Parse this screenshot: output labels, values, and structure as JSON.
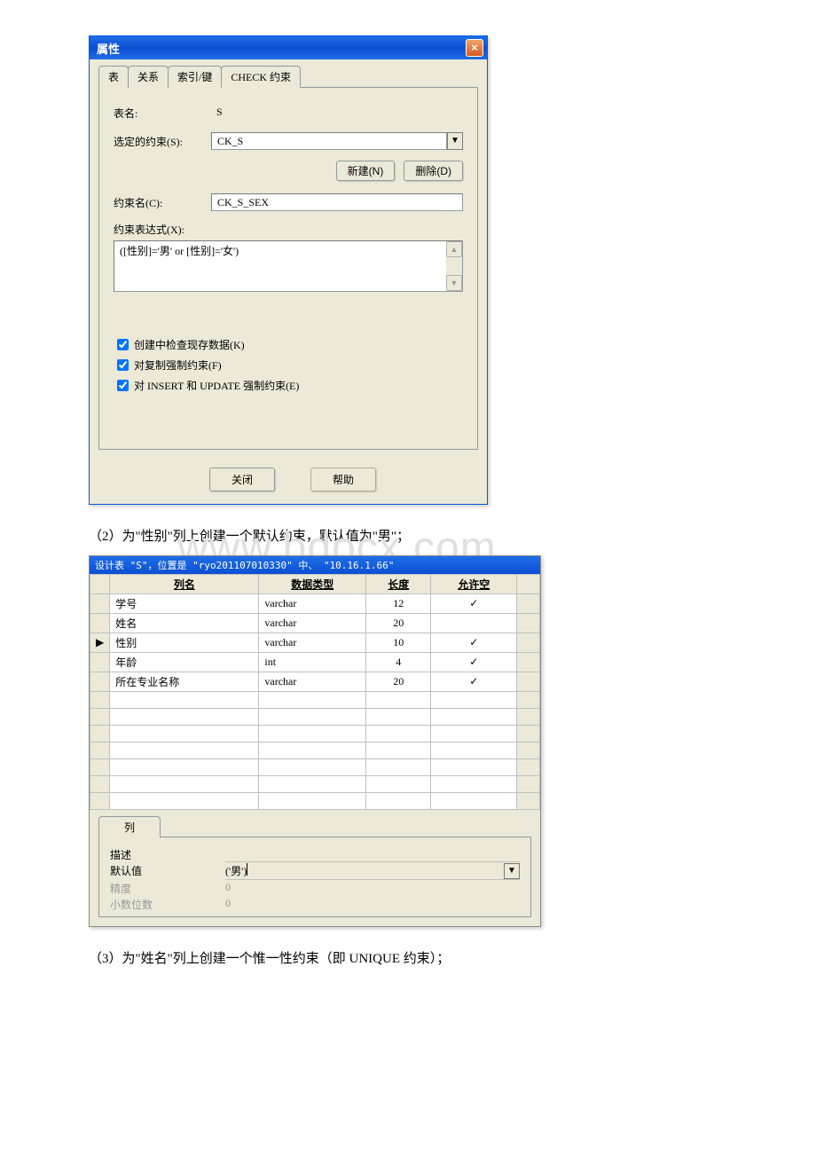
{
  "watermark": "www.bdocx.com",
  "dialog": {
    "title": "属性",
    "tabs": [
      "表",
      "关系",
      "索引/键",
      "CHECK 约束"
    ],
    "tableNameLabel": "表名:",
    "tableNameValue": "S",
    "selectedConstraintLabel": "选定的约束(S):",
    "selectedConstraintValue": "CK_S",
    "newBtn": "新建(N)",
    "deleteBtn": "删除(D)",
    "constraintNameLabel": "约束名(C):",
    "constraintNameValue": "CK_S_SEX",
    "exprLabel": "约束表达式(X):",
    "exprValue": "([性别]='男' or [性别]='女')",
    "chk1": "创建中检查现存数据(K)",
    "chk2": "对复制强制约束(F)",
    "chk3": "对 INSERT 和 UPDATE 强制约束(E)",
    "closeBtn": "关闭",
    "helpBtn": "帮助"
  },
  "text2": "（2）为\"性别\"列上创建一个默认约束，默认值为\"男\"；",
  "designer": {
    "title": "设计表 \"S\"，位置是 \"ryo201107010330\" 中、 \"10.16.1.66\"",
    "headers": [
      "列名",
      "数据类型",
      "长度",
      "允许空"
    ],
    "rows": [
      {
        "name": "学号",
        "type": "varchar",
        "len": "12",
        "null": true
      },
      {
        "name": "姓名",
        "type": "varchar",
        "len": "20",
        "null": false
      },
      {
        "name": "性别",
        "type": "varchar",
        "len": "10",
        "null": true,
        "selected": true
      },
      {
        "name": "年龄",
        "type": "int",
        "len": "4",
        "null": true
      },
      {
        "name": "所在专业名称",
        "type": "varchar",
        "len": "20",
        "null": true
      }
    ],
    "colTab": "列",
    "props": {
      "descLabel": "描述",
      "descValue": "",
      "defaultLabel": "默认值",
      "defaultValue": "('男')",
      "precisionLabel": "精度",
      "precisionValue": "0",
      "scaleLabel": "小数位数",
      "scaleValue": "0"
    }
  },
  "text3": "（3）为\"姓名\"列上创建一个惟一性约束（即 UNIQUE 约束）；"
}
